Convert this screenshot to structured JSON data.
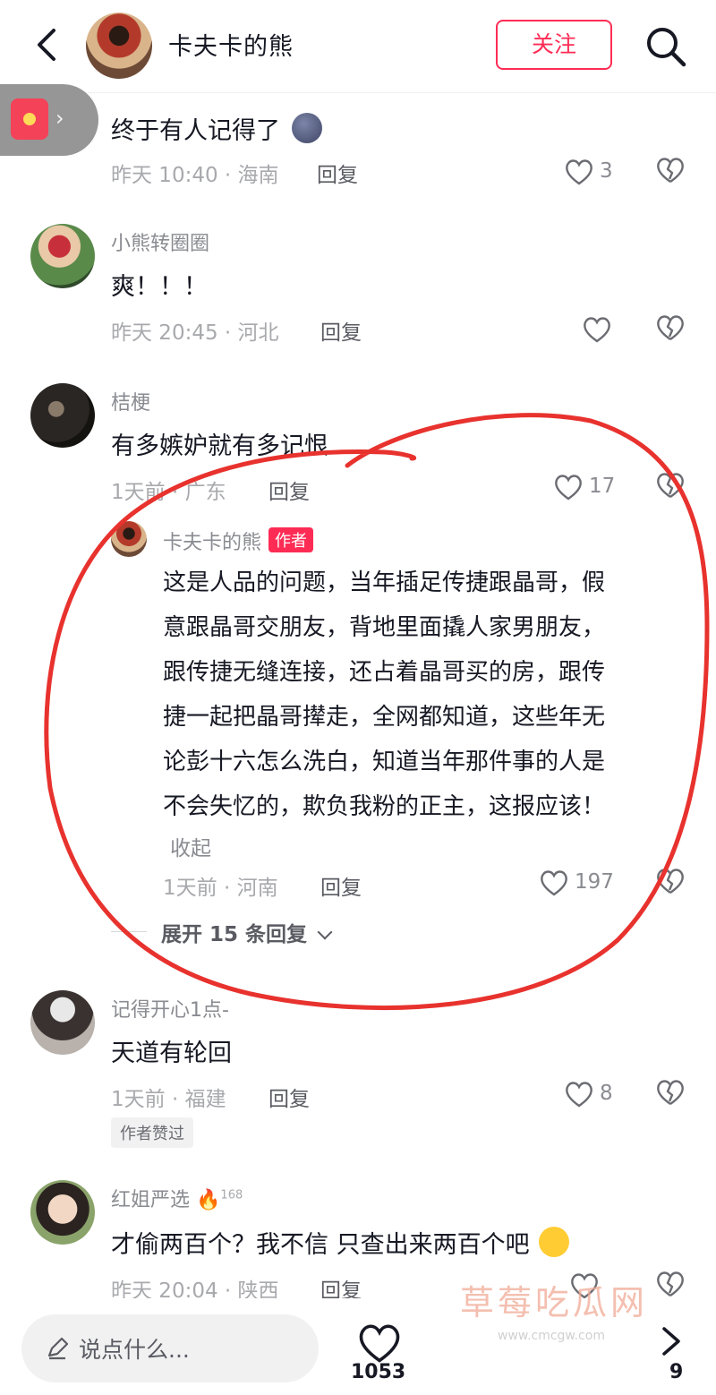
{
  "header": {
    "author_name": "卡夫卡的熊",
    "follow_label": "关注"
  },
  "comments": [
    {
      "text": "终于有人记得了",
      "time": "昨天 10:40 · 海南",
      "reply_label": "回复",
      "likes": "3"
    },
    {
      "user": "小熊转圈圈",
      "text": "爽！！！",
      "time": "昨天 20:45 · 河北",
      "reply_label": "回复",
      "likes": ""
    },
    {
      "user": "桔梗",
      "text": "有多嫉妒就有多记恨",
      "time": "1天前 · 广东",
      "reply_label": "回复",
      "likes": "17"
    },
    {
      "user": "记得开心1点-",
      "text": "天道有轮回",
      "time": "1天前 · 福建",
      "reply_label": "回复",
      "likes": "8",
      "tag": "作者赞过"
    },
    {
      "user": "红姐严选",
      "user_level": "168",
      "text": "才偷两百个？我不信 只查出来两百个吧",
      "time": "昨天 20:04 · 陕西",
      "reply_label": "回复"
    }
  ],
  "author_reply": {
    "user": "卡夫卡的熊",
    "badge": "作者",
    "lines": [
      "这是人品的问题，当年插足传捷跟晶哥，假",
      "意跟晶哥交朋友，背地里面撬人家男朋友，",
      "跟传捷无缝连接，还占着晶哥买的房，跟传",
      "捷一起把晶哥撵走，全网都知道，这些年无",
      "论彭十六怎么洗白，知道当年那件事的人是",
      "不会失忆的，欺负我粉的正主，这报应该！"
    ],
    "collapse_label": "收起",
    "time": "1天前 · 河南",
    "reply_label": "回复",
    "likes": "197",
    "expand_label": "展开 15 条回复"
  },
  "bottom": {
    "input_placeholder": "说点什么...",
    "like_count": "1053",
    "share_count": "9"
  },
  "watermark": {
    "title": "草莓吃瓜网",
    "url": "www.cmcgw.com"
  },
  "colors": {
    "accent": "#fe2c55",
    "annotation": "#e8322e"
  }
}
